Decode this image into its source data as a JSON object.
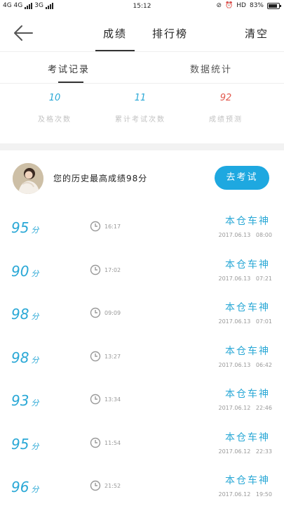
{
  "status_bar": {
    "network_left": "4G 4G",
    "network_sub": "3G",
    "time": "15:12",
    "hd": "HD",
    "battery": "83%"
  },
  "header": {
    "tabs": [
      {
        "label": "成绩"
      },
      {
        "label": "排行榜"
      }
    ],
    "clear_label": "清空"
  },
  "subtabs": [
    {
      "label": "考试记录"
    },
    {
      "label": "数据统计"
    }
  ],
  "stats": [
    {
      "value": "10",
      "label": "及格次数"
    },
    {
      "value": "11",
      "label": "累计考试次数"
    },
    {
      "value": "92",
      "label": "成绩预测"
    }
  ],
  "best": {
    "text": "您的历史最高成绩98分",
    "button_label": "去考试"
  },
  "records": [
    {
      "score": "95",
      "unit": "分",
      "time": "16:17",
      "name": "本仓车神",
      "date": "2017.06.13   08:00"
    },
    {
      "score": "90",
      "unit": "分",
      "time": "17:02",
      "name": "本仓车神",
      "date": "2017.06.13   07:21"
    },
    {
      "score": "98",
      "unit": "分",
      "time": "09:09",
      "name": "本仓车神",
      "date": "2017.06.13   07:01"
    },
    {
      "score": "98",
      "unit": "分",
      "time": "13:27",
      "name": "本仓车神",
      "date": "2017.06.13   06:42"
    },
    {
      "score": "93",
      "unit": "分",
      "time": "13:34",
      "name": "本仓车神",
      "date": "2017.06.12   22:46"
    },
    {
      "score": "95",
      "unit": "分",
      "time": "11:54",
      "name": "本仓车神",
      "date": "2017.06.12   22:33"
    },
    {
      "score": "96",
      "unit": "分",
      "time": "21:52",
      "name": "本仓车神",
      "date": "2017.06.12   19:50"
    }
  ],
  "colors": {
    "accent": "#2aa8d6",
    "button": "#1ea8e0",
    "prediction": "#e25a4e"
  }
}
